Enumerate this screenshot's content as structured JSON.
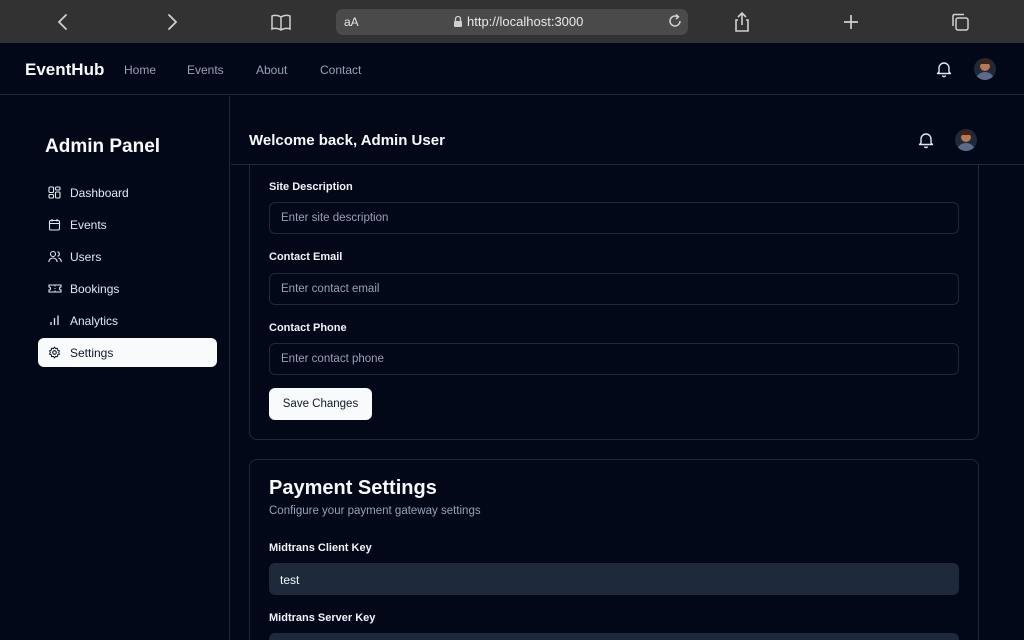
{
  "browser": {
    "text_size_label": "aA",
    "url": "http://localhost:3000"
  },
  "nav": {
    "brand": "EventHub",
    "links": [
      "Home",
      "Events",
      "About",
      "Contact"
    ]
  },
  "sidebar": {
    "title": "Admin Panel",
    "items": [
      {
        "label": "Dashboard",
        "icon": "dashboard-icon"
      },
      {
        "label": "Events",
        "icon": "calendar-icon"
      },
      {
        "label": "Users",
        "icon": "users-icon"
      },
      {
        "label": "Bookings",
        "icon": "ticket-icon"
      },
      {
        "label": "Analytics",
        "icon": "bar-chart-icon"
      },
      {
        "label": "Settings",
        "icon": "gear-icon",
        "active": true
      }
    ]
  },
  "header": {
    "welcome": "Welcome back, Admin User"
  },
  "general": {
    "site_description_label": "Site Description",
    "site_description_placeholder": "Enter site description",
    "contact_email_label": "Contact Email",
    "contact_email_placeholder": "Enter contact email",
    "contact_phone_label": "Contact Phone",
    "contact_phone_placeholder": "Enter contact phone",
    "save_label": "Save Changes"
  },
  "payment": {
    "title": "Payment Settings",
    "subtitle": "Configure your payment gateway settings",
    "client_key_label": "Midtrans Client Key",
    "client_key_value": "test",
    "server_key_label": "Midtrans Server Key"
  },
  "colors": {
    "background": "#020817",
    "border": "#1e293b",
    "muted_text": "#94a3b8",
    "active_bg": "#f8fafc"
  }
}
